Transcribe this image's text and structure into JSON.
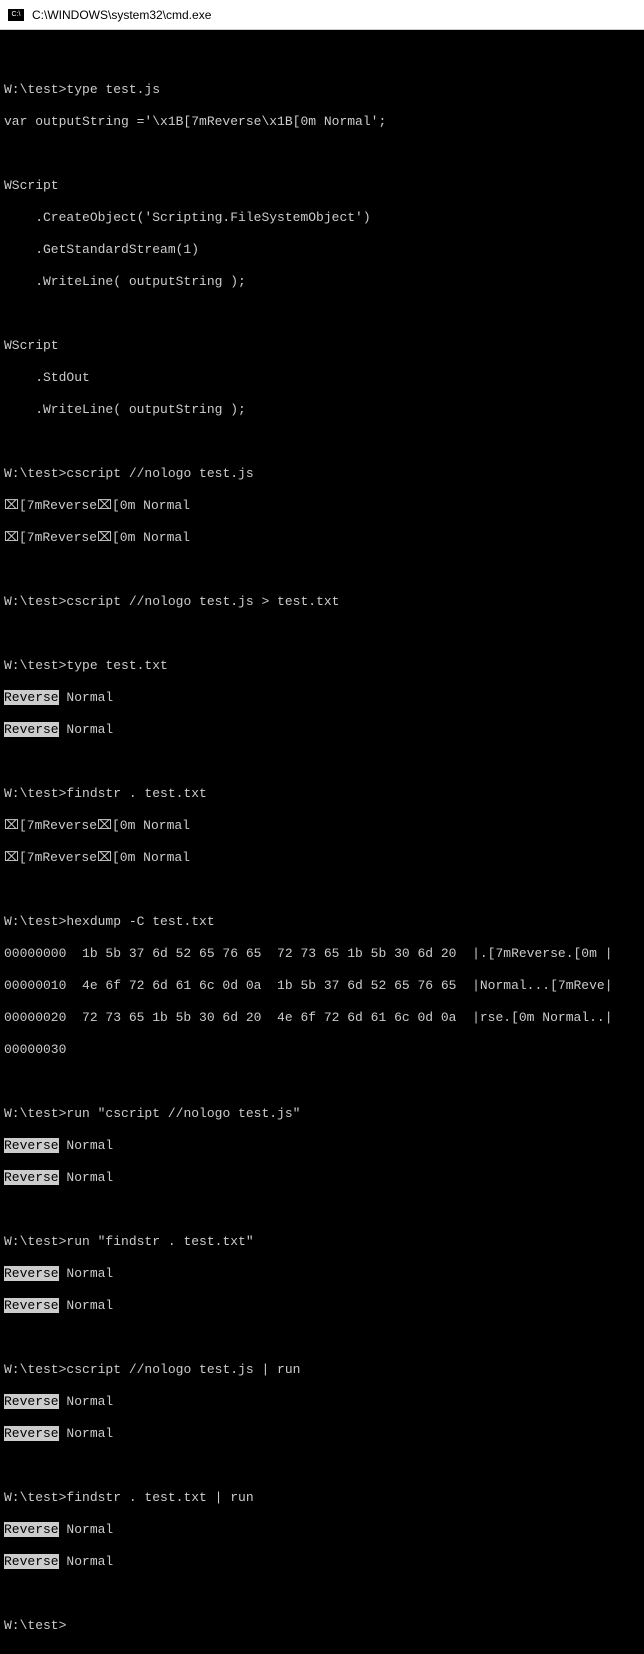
{
  "window": {
    "title": "C:\\WINDOWS\\system32\\cmd.exe"
  },
  "prompt": "W:\\test>",
  "cmds": {
    "type_js": "type test.js",
    "cscript1": "cscript //nologo test.js",
    "cscript_redirect": "cscript //nologo test.js > test.txt",
    "type_txt": "type test.txt",
    "findstr": "findstr . test.txt",
    "hexdump": "hexdump -C test.txt",
    "run_cscript": "run \"cscript //nologo test.js\"",
    "run_findstr": "run \"findstr . test.txt\"",
    "cscript_pipe": "cscript //nologo test.js | run",
    "findstr_pipe": "findstr . test.txt | run"
  },
  "file_content": {
    "line1": "var outputString ='\\x1B[7mReverse\\x1B[0m Normal';",
    "line2": "",
    "line3": "WScript",
    "line4": "    .CreateObject('Scripting.FileSystemObject')",
    "line5": "    .GetStandardStream(1)",
    "line6": "    .WriteLine( outputString );",
    "line7": "",
    "line8": "WScript",
    "line9": "    .StdOut",
    "line10": "    .WriteLine( outputString );"
  },
  "output": {
    "raw_escape": "⌧[7mReverse⌧[0m Normal",
    "reverse_word": "Reverse",
    "normal_word": " Normal"
  },
  "hexdump": {
    "l1": "00000000  1b 5b 37 6d 52 65 76 65  72 73 65 1b 5b 30 6d 20  |.[7mReverse.[0m |",
    "l2": "00000010  4e 6f 72 6d 61 6c 0d 0a  1b 5b 37 6d 52 65 76 65  |Normal...[7mReve|",
    "l3": "00000020  72 73 65 1b 5b 30 6d 20  4e 6f 72 6d 61 6c 0d 0a  |rse.[0m Normal..|",
    "l4": "00000030"
  }
}
